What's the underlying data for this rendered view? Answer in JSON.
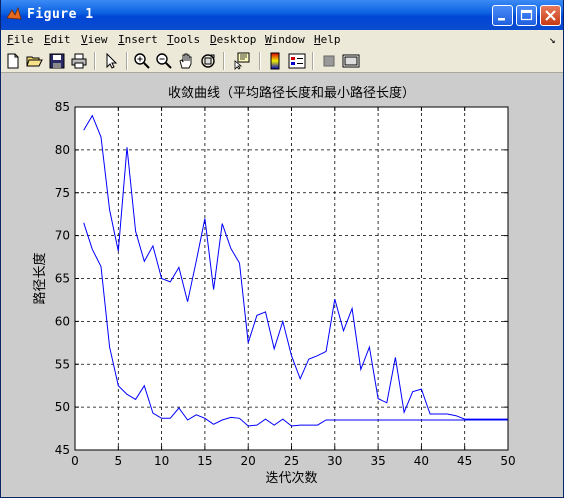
{
  "window": {
    "title": "Figure 1"
  },
  "menu": [
    {
      "label": "File",
      "key": "F",
      "rest": "ile"
    },
    {
      "label": "Edit",
      "key": "E",
      "rest": "dit"
    },
    {
      "label": "View",
      "key": "V",
      "rest": "iew"
    },
    {
      "label": "Insert",
      "key": "I",
      "rest": "nsert"
    },
    {
      "label": "Tools",
      "key": "T",
      "rest": "ools"
    },
    {
      "label": "Desktop",
      "key": "D",
      "rest": "esktop"
    },
    {
      "label": "Window",
      "key": "W",
      "rest": "indow"
    },
    {
      "label": "Help",
      "key": "H",
      "rest": "elp"
    }
  ],
  "menu_dock_glyph": "↘",
  "toolbar_icons": [
    "new-file-icon",
    "open-folder-icon",
    "save-icon",
    "print-icon",
    "pointer-arrow-icon",
    "zoom-in-icon",
    "zoom-out-icon",
    "pan-hand-icon",
    "rotate-3d-icon",
    "data-cursor-icon",
    "colorbar-icon",
    "legend-icon",
    "hide-plot-tools-icon",
    "show-plot-tools-icon"
  ],
  "colors": {
    "line": "#0000ff",
    "axes_bg": "#ffffff",
    "figure_bg": "#cccccc",
    "titlebar": "#0a5fe0"
  },
  "chart_data": {
    "type": "line",
    "title": "收敛曲线（平均路径长度和最小路径长度）",
    "xlabel": "迭代次数",
    "ylabel": "路径长度",
    "xlim": [
      0,
      50
    ],
    "ylim": [
      45,
      85
    ],
    "xticks": [
      0,
      5,
      10,
      15,
      20,
      25,
      30,
      35,
      40,
      45,
      50
    ],
    "yticks": [
      45,
      50,
      55,
      60,
      65,
      70,
      75,
      80,
      85
    ],
    "grid": true,
    "grid_style": "dashed",
    "x": [
      1,
      2,
      3,
      4,
      5,
      6,
      7,
      8,
      9,
      10,
      11,
      12,
      13,
      14,
      15,
      16,
      17,
      18,
      19,
      20,
      21,
      22,
      23,
      24,
      25,
      26,
      27,
      28,
      29,
      30,
      31,
      32,
      33,
      34,
      35,
      36,
      37,
      38,
      39,
      40,
      41,
      42,
      43,
      44,
      45,
      46,
      47,
      48,
      49,
      50
    ],
    "series": [
      {
        "values": [
          82.3,
          84.0,
          81.5,
          73.0,
          68.2,
          80.3,
          70.5,
          67.0,
          68.8,
          65.0,
          64.6,
          66.3,
          62.3,
          67.0,
          72.0,
          63.7,
          71.4,
          68.5,
          66.8,
          57.5,
          60.7,
          61.1,
          56.8,
          60.0,
          56.0,
          53.3,
          55.6,
          56.0,
          56.5,
          62.6,
          58.9,
          61.5,
          54.4,
          57.0,
          51.0,
          50.5,
          55.8,
          49.4,
          51.8,
          52.1,
          49.2,
          49.2,
          49.2,
          49.0,
          48.6,
          48.6,
          48.6,
          48.6,
          48.6,
          48.6
        ]
      },
      {
        "values": [
          71.5,
          68.4,
          66.4,
          57.0,
          52.5,
          51.5,
          50.9,
          52.5,
          49.3,
          48.7,
          48.7,
          49.9,
          48.5,
          49.1,
          48.7,
          48.0,
          48.5,
          48.8,
          48.7,
          47.8,
          47.9,
          48.6,
          47.9,
          48.6,
          47.8,
          47.9,
          47.9,
          47.9,
          48.5,
          48.5,
          48.5,
          48.5,
          48.5,
          48.5,
          48.5,
          48.5,
          48.5,
          48.5,
          48.5,
          48.5,
          48.5,
          48.5,
          48.5,
          48.5,
          48.5,
          48.5,
          48.5,
          48.5,
          48.5,
          48.5
        ]
      }
    ]
  }
}
